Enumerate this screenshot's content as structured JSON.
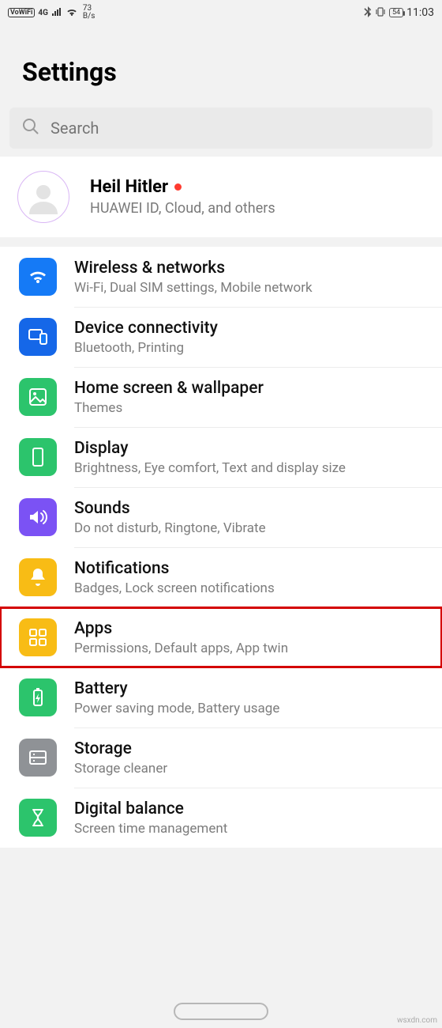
{
  "status": {
    "vowifi": "VoWiFi",
    "net": "4G",
    "speed_top": "73",
    "speed_bot": "B/s",
    "battery": "54",
    "time": "11:03"
  },
  "header": {
    "title": "Settings"
  },
  "search": {
    "placeholder": "Search"
  },
  "account": {
    "name": "Heil Hitler",
    "sub": "HUAWEI ID, Cloud, and others"
  },
  "items": [
    {
      "title": "Wireless & networks",
      "sub": "Wi-Fi, Dual SIM settings, Mobile network",
      "color": "c-blue",
      "icon": "wifi-icon",
      "highlight": false
    },
    {
      "title": "Device connectivity",
      "sub": "Bluetooth, Printing",
      "color": "c-blue2",
      "icon": "devices-icon",
      "highlight": false
    },
    {
      "title": "Home screen & wallpaper",
      "sub": "Themes",
      "color": "c-green",
      "icon": "wallpaper-icon",
      "highlight": false
    },
    {
      "title": "Display",
      "sub": "Brightness, Eye comfort, Text and display size",
      "color": "c-green2",
      "icon": "display-icon",
      "highlight": false
    },
    {
      "title": "Sounds",
      "sub": "Do not disturb, Ringtone, Vibrate",
      "color": "c-purple",
      "icon": "sound-icon",
      "highlight": false
    },
    {
      "title": "Notifications",
      "sub": "Badges, Lock screen notifications",
      "color": "c-yellow",
      "icon": "bell-icon",
      "highlight": false
    },
    {
      "title": "Apps",
      "sub": "Permissions, Default apps, App twin",
      "color": "c-yellow2",
      "icon": "apps-icon",
      "highlight": true
    },
    {
      "title": "Battery",
      "sub": "Power saving mode, Battery usage",
      "color": "c-green3",
      "icon": "battery-icon",
      "highlight": false
    },
    {
      "title": "Storage",
      "sub": "Storage cleaner",
      "color": "c-grey",
      "icon": "storage-icon",
      "highlight": false
    },
    {
      "title": "Digital balance",
      "sub": "Screen time management",
      "color": "c-green4",
      "icon": "hourglass-icon",
      "highlight": false
    }
  ],
  "watermark": "wsxdn.com"
}
